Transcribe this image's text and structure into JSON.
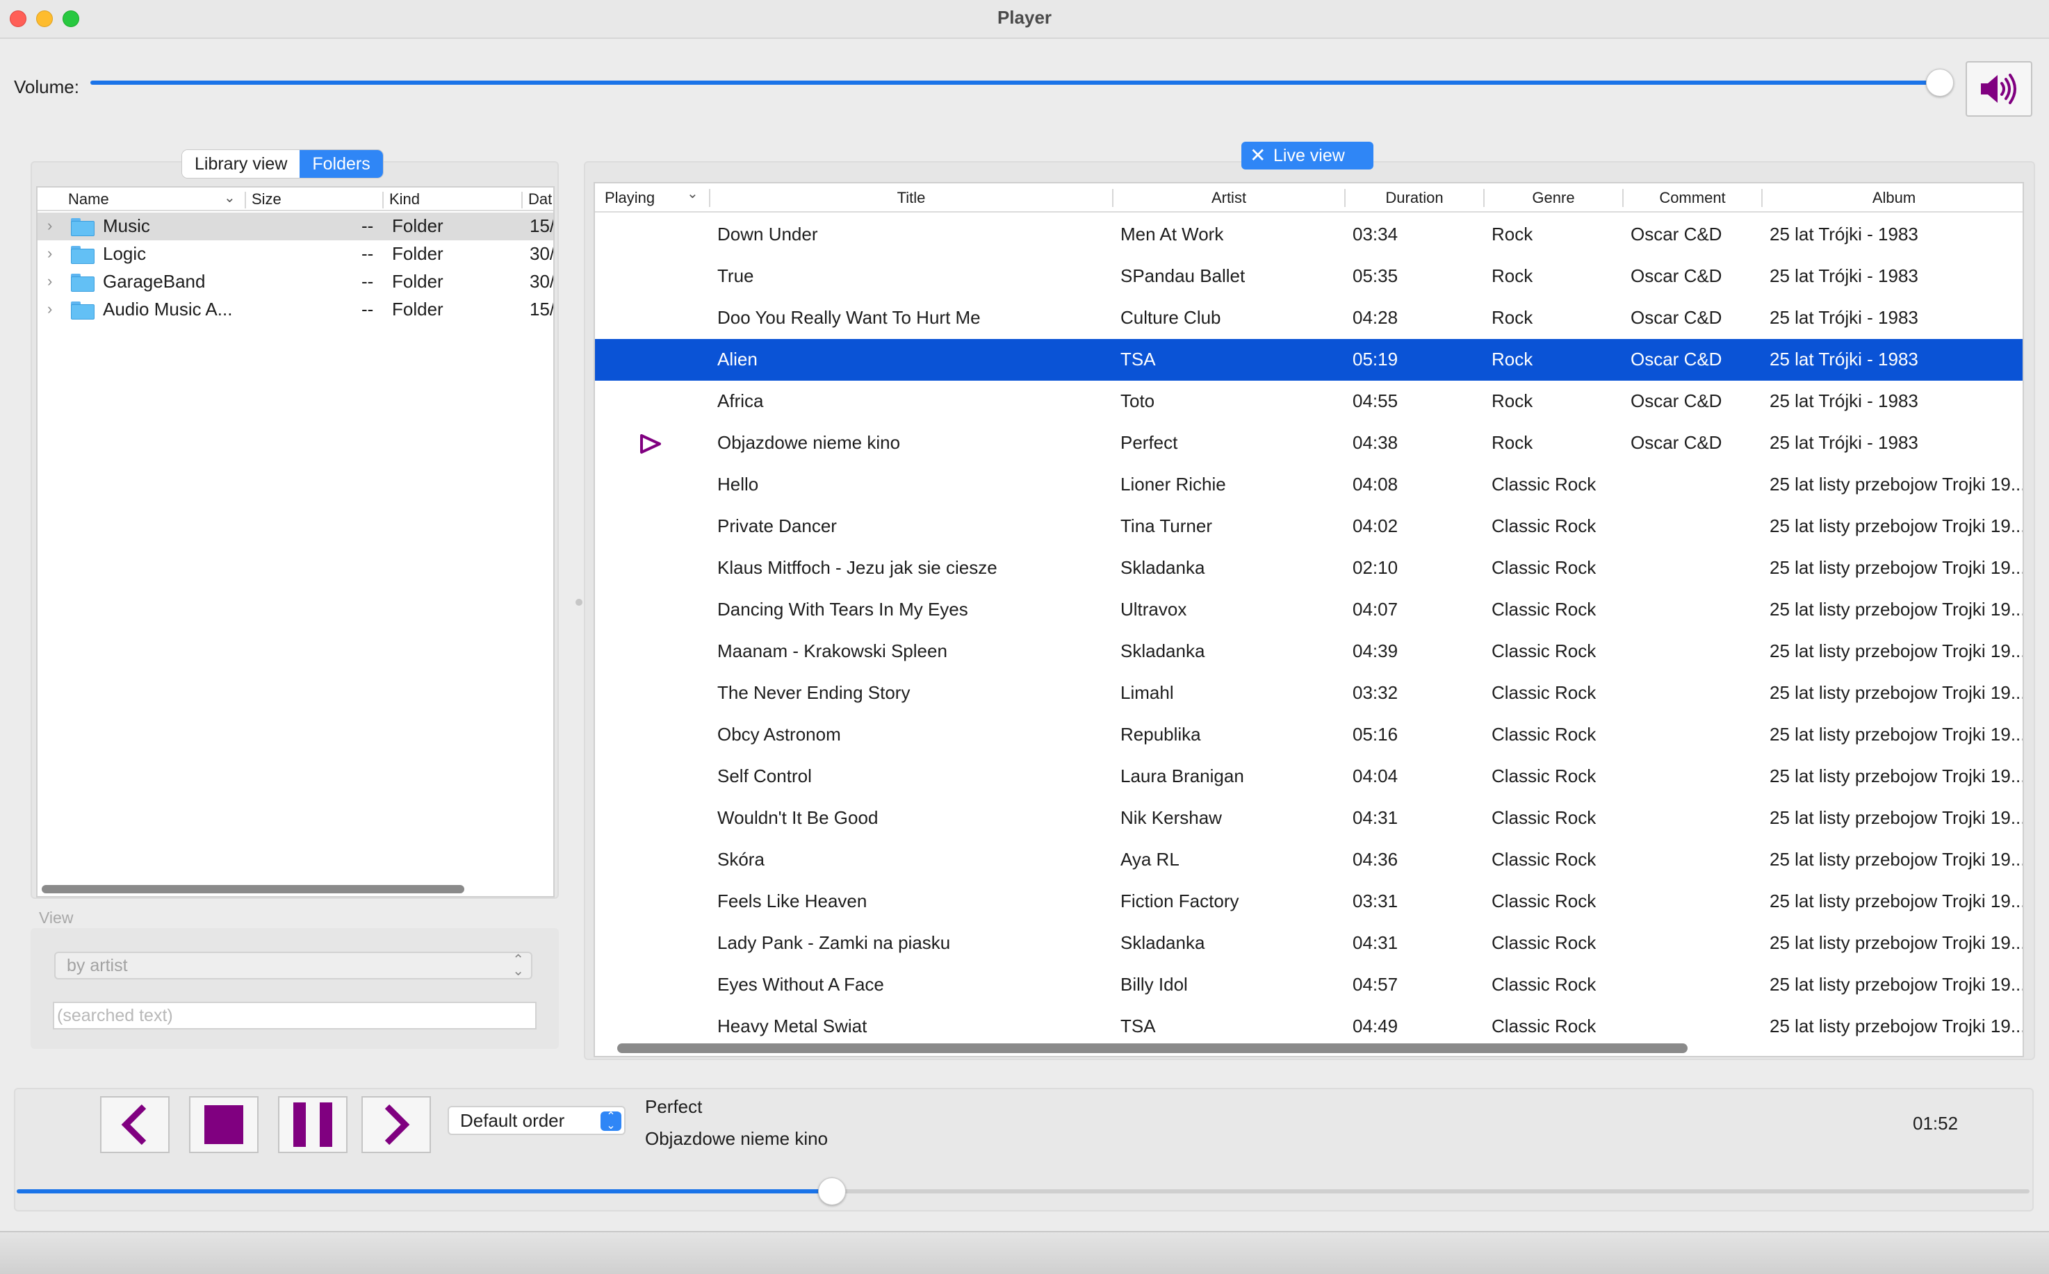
{
  "window": {
    "title": "Player"
  },
  "volume": {
    "label": "Volume:",
    "level": 0.995,
    "speaker_icon": "speaker-high-icon"
  },
  "library": {
    "tabs": [
      {
        "label": "Library view",
        "active": false
      },
      {
        "label": "Folders",
        "active": true
      }
    ],
    "columns": [
      "Name",
      "Size",
      "Kind",
      "Dat"
    ],
    "rows": [
      {
        "name": "Music",
        "size": "--",
        "kind": "Folder",
        "date": "15/",
        "selected": true
      },
      {
        "name": "Logic",
        "size": "--",
        "kind": "Folder",
        "date": "30/",
        "selected": false
      },
      {
        "name": "GarageBand",
        "size": "--",
        "kind": "Folder",
        "date": "30/",
        "selected": false
      },
      {
        "name": "Audio Music A...",
        "size": "--",
        "kind": "Folder",
        "date": "15/",
        "selected": false
      }
    ]
  },
  "view": {
    "label": "View",
    "by_value": "by artist",
    "search_placeholder": "(searched text)"
  },
  "live_view": {
    "label": "Live view"
  },
  "tracks": {
    "columns": [
      "Playing",
      "Title",
      "Artist",
      "Duration",
      "Genre",
      "Comment",
      "Album"
    ],
    "rows": [
      {
        "title": "Down Under",
        "artist": "Men At Work",
        "duration": "03:34",
        "genre": "Rock",
        "comment": "Oscar C&D",
        "album": "25 lat Trójki - 1983",
        "selected": false,
        "playing": false
      },
      {
        "title": "True",
        "artist": "SPandau Ballet",
        "duration": "05:35",
        "genre": "Rock",
        "comment": "Oscar C&D",
        "album": "25 lat Trójki - 1983",
        "selected": false,
        "playing": false
      },
      {
        "title": "Doo You Really Want To Hurt Me",
        "artist": "Culture Club",
        "duration": "04:28",
        "genre": "Rock",
        "comment": "Oscar C&D",
        "album": "25 lat Trójki - 1983",
        "selected": false,
        "playing": false
      },
      {
        "title": "Alien",
        "artist": "TSA",
        "duration": "05:19",
        "genre": "Rock",
        "comment": "Oscar C&D",
        "album": "25 lat Trójki - 1983",
        "selected": true,
        "playing": false
      },
      {
        "title": "Africa",
        "artist": "Toto",
        "duration": "04:55",
        "genre": "Rock",
        "comment": "Oscar C&D",
        "album": "25 lat Trójki - 1983",
        "selected": false,
        "playing": false
      },
      {
        "title": "Objazdowe nieme kino",
        "artist": "Perfect",
        "duration": "04:38",
        "genre": "Rock",
        "comment": "Oscar C&D",
        "album": "25 lat Trójki - 1983",
        "selected": false,
        "playing": true
      },
      {
        "title": "Hello",
        "artist": "Lioner Richie",
        "duration": "04:08",
        "genre": "Classic Rock",
        "comment": "",
        "album": "25 lat listy przebojow Trojki 19...",
        "selected": false,
        "playing": false
      },
      {
        "title": "Private Dancer",
        "artist": "Tina Turner",
        "duration": "04:02",
        "genre": "Classic Rock",
        "comment": "",
        "album": "25 lat listy przebojow Trojki 19...",
        "selected": false,
        "playing": false
      },
      {
        "title": "Klaus Mitffoch - Jezu jak sie ciesze",
        "artist": "Skladanka",
        "duration": "02:10",
        "genre": "Classic Rock",
        "comment": "",
        "album": "25 lat listy przebojow Trojki 19...",
        "selected": false,
        "playing": false
      },
      {
        "title": "Dancing With Tears In My Eyes",
        "artist": "Ultravox",
        "duration": "04:07",
        "genre": "Classic Rock",
        "comment": "",
        "album": "25 lat listy przebojow Trojki 19...",
        "selected": false,
        "playing": false
      },
      {
        "title": "Maanam - Krakowski Spleen",
        "artist": "Skladanka",
        "duration": "04:39",
        "genre": "Classic Rock",
        "comment": "",
        "album": "25 lat listy przebojow Trojki 19...",
        "selected": false,
        "playing": false
      },
      {
        "title": "The Never Ending Story",
        "artist": "Limahl",
        "duration": "03:32",
        "genre": "Classic Rock",
        "comment": "",
        "album": "25 lat listy przebojow Trojki 19...",
        "selected": false,
        "playing": false
      },
      {
        "title": "Obcy Astronom",
        "artist": "Republika",
        "duration": "05:16",
        "genre": "Classic Rock",
        "comment": "",
        "album": "25 lat listy przebojow Trojki 19...",
        "selected": false,
        "playing": false
      },
      {
        "title": "Self Control",
        "artist": "Laura Branigan",
        "duration": "04:04",
        "genre": "Classic Rock",
        "comment": "",
        "album": "25 lat listy przebojow Trojki 19...",
        "selected": false,
        "playing": false
      },
      {
        "title": "Wouldn't It Be Good",
        "artist": "Nik Kershaw",
        "duration": "04:31",
        "genre": "Classic Rock",
        "comment": "",
        "album": "25 lat listy przebojow Trojki 19...",
        "selected": false,
        "playing": false
      },
      {
        "title": "Skóra",
        "artist": "Aya RL",
        "duration": "04:36",
        "genre": "Classic Rock",
        "comment": "",
        "album": "25 lat listy przebojow Trojki 19...",
        "selected": false,
        "playing": false
      },
      {
        "title": "Feels Like Heaven",
        "artist": "Fiction Factory",
        "duration": "03:31",
        "genre": "Classic Rock",
        "comment": "",
        "album": "25 lat listy przebojow Trojki 19...",
        "selected": false,
        "playing": false
      },
      {
        "title": "Lady Pank - Zamki na piasku",
        "artist": "Skladanka",
        "duration": "04:31",
        "genre": "Classic Rock",
        "comment": "",
        "album": "25 lat listy przebojow Trojki 19...",
        "selected": false,
        "playing": false
      },
      {
        "title": "Eyes Without A Face",
        "artist": "Billy Idol",
        "duration": "04:57",
        "genre": "Classic Rock",
        "comment": "",
        "album": "25 lat listy przebojow Trojki 19...",
        "selected": false,
        "playing": false
      },
      {
        "title": "Heavy Metal Swiat",
        "artist": "TSA",
        "duration": "04:49",
        "genre": "Classic Rock",
        "comment": "",
        "album": "25 lat listy przebojow Trojki 19...",
        "selected": false,
        "playing": false
      }
    ]
  },
  "transport": {
    "order": "Default order",
    "now_playing_artist": "Perfect",
    "now_playing_title": "Objazdowe nieme kino",
    "elapsed": "01:52",
    "progress": 0.405,
    "accent_color": "#800080"
  }
}
